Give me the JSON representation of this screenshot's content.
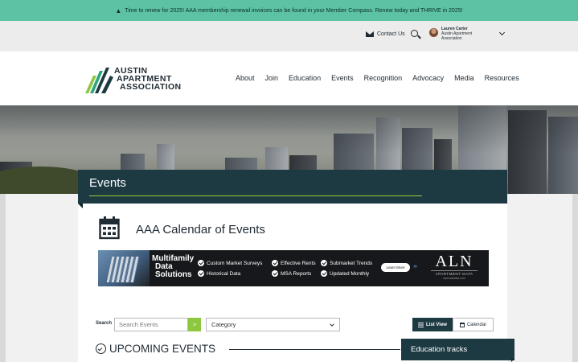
{
  "alert": {
    "icon": "warning-icon",
    "text": "Time to renew for 2025!  AAA membership renewal invoices can be found in your Member Compass.  Renew today and THRIVE in 2025!"
  },
  "utility": {
    "contact_label": "Contact Us",
    "contact_icon": "envelope-icon",
    "search_icon": "search-icon",
    "user_name": "Lauren Carter",
    "user_org_line1": "Austin Apartment",
    "user_org_line2": "Association",
    "dropdown_icon": "chevron-down-icon"
  },
  "header": {
    "logo_line1": "AUSTIN",
    "logo_line2": "APARTMENT",
    "logo_line3": "ASSOCIATION",
    "nav": [
      "About",
      "Join",
      "Education",
      "Events",
      "Recognition",
      "Advocacy",
      "Media",
      "Resources"
    ]
  },
  "events": {
    "banner_title": "Events",
    "calendar_title": "AAA Calendar of Events",
    "calendar_icon": "calendar-icon"
  },
  "ad": {
    "headline": [
      "Multifamily",
      "Data",
      "Solutions"
    ],
    "features": [
      "Custom Market Surveys",
      "Effective Rents",
      "Submarket Trends",
      "Historical Data",
      "MSA Reports",
      "Updated Monthly"
    ],
    "cta": "Learn More",
    "brand": "ALN",
    "brand_sub": "APARTMENT DATA",
    "brand_url": "www.alndata.com"
  },
  "filters": {
    "search_label": "Search",
    "search_placeholder": "Search Events",
    "search_go": ">",
    "category_value": "Category",
    "list_view_label": "List View",
    "calendar_label": "Calendar"
  },
  "upcoming": {
    "heading": "UPCOMING EVENTS",
    "tracks_label": "Education tracks"
  },
  "colors": {
    "alert_bg": "#5cc2a3",
    "navy": "#1d3a43",
    "accent_green": "#8dc63f"
  }
}
